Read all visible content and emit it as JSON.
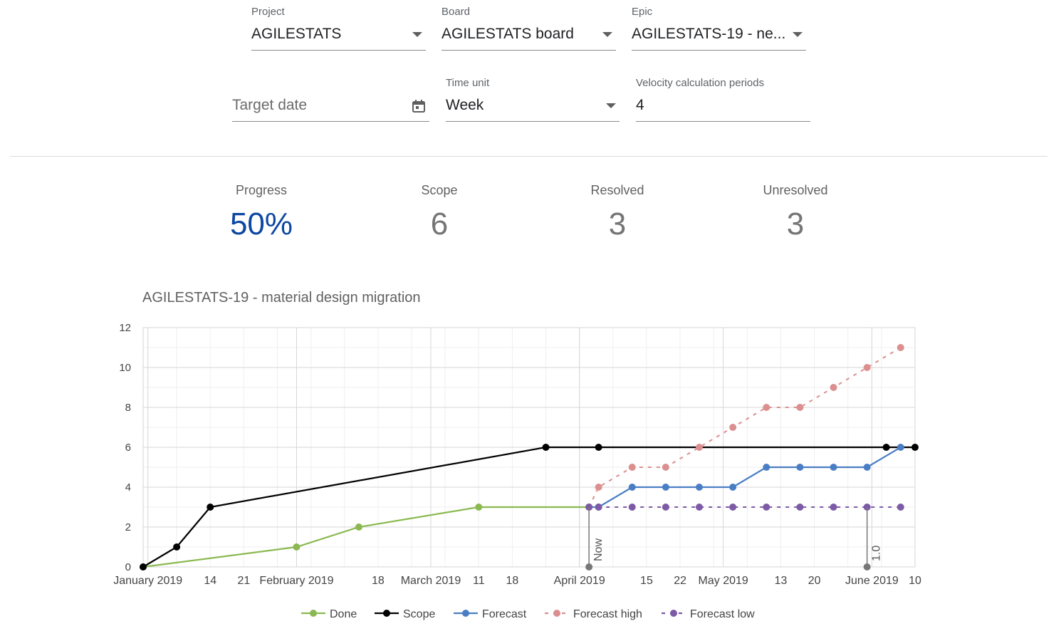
{
  "filters": {
    "project": {
      "label": "Project",
      "value": "AGILESTATS"
    },
    "board": {
      "label": "Board",
      "value": "AGILESTATS board"
    },
    "epic": {
      "label": "Epic",
      "value": "AGILESTATS-19 - ne..."
    },
    "target_date": {
      "placeholder": "Target date"
    },
    "time_unit": {
      "label": "Time unit",
      "value": "Week"
    },
    "velocity": {
      "label": "Velocity calculation periods",
      "value": "4"
    }
  },
  "stats": {
    "progress": {
      "label": "Progress",
      "value": "50%"
    },
    "scope": {
      "label": "Scope",
      "value": "6"
    },
    "resolved": {
      "label": "Resolved",
      "value": "3"
    },
    "unresolved": {
      "label": "Unresolved",
      "value": "3"
    }
  },
  "colors": {
    "accent": "#0d47a1",
    "done": "#8bb950",
    "scope": "#000000",
    "forecast": "#4a7ec4",
    "forecast_high": "#dc8f8f",
    "forecast_low": "#7c5aa6"
  },
  "chart_data": {
    "type": "line",
    "title": "AGILESTATS-19 - material design migration",
    "x_range": [
      "2018-12-31",
      "2019-06-10"
    ],
    "ylim": [
      0,
      12
    ],
    "yticks": [
      0,
      2,
      4,
      6,
      8,
      10,
      12
    ],
    "xticks": [
      {
        "date": "2019-01-01",
        "label": "January 2019",
        "major": true
      },
      {
        "date": "2019-01-14",
        "label": "14",
        "major": false
      },
      {
        "date": "2019-01-21",
        "label": "21",
        "major": false
      },
      {
        "date": "2019-02-01",
        "label": "February 2019",
        "major": true
      },
      {
        "date": "2019-02-18",
        "label": "18",
        "major": false
      },
      {
        "date": "2019-03-01",
        "label": "March 2019",
        "major": true
      },
      {
        "date": "2019-03-11",
        "label": "11",
        "major": false
      },
      {
        "date": "2019-03-18",
        "label": "18",
        "major": false
      },
      {
        "date": "2019-04-01",
        "label": "April 2019",
        "major": true
      },
      {
        "date": "2019-04-15",
        "label": "15",
        "major": false
      },
      {
        "date": "2019-04-22",
        "label": "22",
        "major": false
      },
      {
        "date": "2019-05-01",
        "label": "May 2019",
        "major": true
      },
      {
        "date": "2019-05-13",
        "label": "13",
        "major": false
      },
      {
        "date": "2019-05-20",
        "label": "20",
        "major": false
      },
      {
        "date": "2019-06-01",
        "label": "June 2019",
        "major": true
      },
      {
        "date": "2019-06-10",
        "label": "10",
        "major": false
      }
    ],
    "grid": true,
    "legend_position": "bottom",
    "series": [
      {
        "name": "Done",
        "color": "#8bb950",
        "dashed": false,
        "points": [
          [
            "2018-12-31",
            0
          ],
          [
            "2019-02-01",
            1
          ],
          [
            "2019-02-14",
            2
          ],
          [
            "2019-03-11",
            3
          ],
          [
            "2019-04-03",
            3
          ]
        ]
      },
      {
        "name": "Scope",
        "color": "#000000",
        "dashed": false,
        "points": [
          [
            "2018-12-31",
            0
          ],
          [
            "2019-01-07",
            1
          ],
          [
            "2019-01-14",
            3
          ],
          [
            "2019-03-25",
            6
          ],
          [
            "2019-04-05",
            6
          ],
          [
            "2019-06-04",
            6
          ],
          [
            "2019-06-10",
            6
          ]
        ]
      },
      {
        "name": "Forecast",
        "color": "#4a7ec4",
        "dashed": false,
        "points": [
          [
            "2019-04-03",
            3
          ],
          [
            "2019-04-05",
            3
          ],
          [
            "2019-04-12",
            4
          ],
          [
            "2019-04-19",
            4
          ],
          [
            "2019-04-26",
            4
          ],
          [
            "2019-05-03",
            4
          ],
          [
            "2019-05-10",
            5
          ],
          [
            "2019-05-17",
            5
          ],
          [
            "2019-05-24",
            5
          ],
          [
            "2019-05-31",
            5
          ],
          [
            "2019-06-07",
            6
          ]
        ]
      },
      {
        "name": "Forecast high",
        "color": "#dc8f8f",
        "dashed": true,
        "points": [
          [
            "2019-04-03",
            3
          ],
          [
            "2019-04-05",
            4
          ],
          [
            "2019-04-12",
            5
          ],
          [
            "2019-04-19",
            5
          ],
          [
            "2019-04-26",
            6
          ],
          [
            "2019-05-03",
            7
          ],
          [
            "2019-05-10",
            8
          ],
          [
            "2019-05-17",
            8
          ],
          [
            "2019-05-24",
            9
          ],
          [
            "2019-05-31",
            10
          ],
          [
            "2019-06-07",
            11
          ]
        ]
      },
      {
        "name": "Forecast low",
        "color": "#7c5aa6",
        "dashed": true,
        "points": [
          [
            "2019-04-03",
            3
          ],
          [
            "2019-04-05",
            3
          ],
          [
            "2019-04-12",
            3
          ],
          [
            "2019-04-19",
            3
          ],
          [
            "2019-04-26",
            3
          ],
          [
            "2019-05-03",
            3
          ],
          [
            "2019-05-10",
            3
          ],
          [
            "2019-05-17",
            3
          ],
          [
            "2019-05-24",
            3
          ],
          [
            "2019-05-31",
            3
          ],
          [
            "2019-06-07",
            3
          ]
        ]
      }
    ],
    "annotations": [
      {
        "label": "Now",
        "date": "2019-04-03"
      },
      {
        "label": "1.0",
        "date": "2019-05-31"
      }
    ]
  }
}
